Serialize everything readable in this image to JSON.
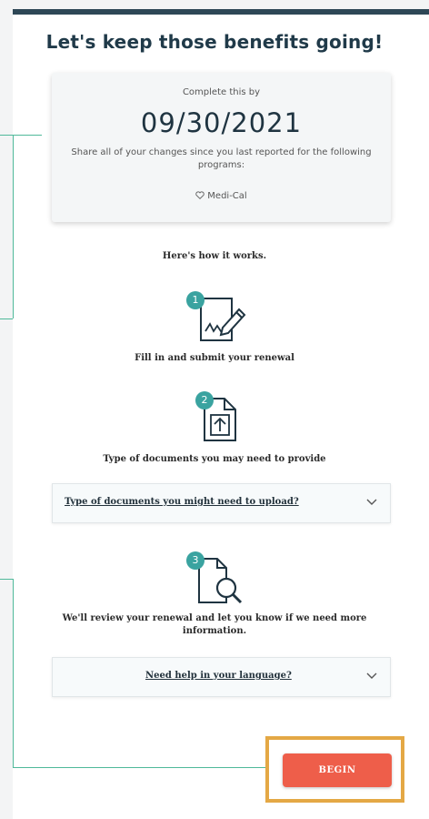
{
  "page": {
    "title": "Let's keep those benefits going!"
  },
  "info_card": {
    "complete_by_label": "Complete this by",
    "due_date": "09/30/2021",
    "share_text": "Share all of your changes since you last reported for the following programs:",
    "program": "Medi-Cal",
    "program_icon": "heart-icon"
  },
  "how_it_works": {
    "heading": "Here's how it works.",
    "steps": [
      {
        "number": "1",
        "text": "Fill in and submit your renewal",
        "icon": "form-signature-icon"
      },
      {
        "number": "2",
        "text": "Type of documents you may need to provide",
        "icon": "document-upload-icon"
      },
      {
        "number": "3",
        "text": "We'll review your renewal and let you know if we need more information.",
        "icon": "document-search-icon"
      }
    ]
  },
  "accordions": {
    "documents": {
      "label": "Type of documents you might need to upload?"
    },
    "language": {
      "label": "Need help in your language?"
    }
  },
  "actions": {
    "begin_label": "BEGIN"
  },
  "colors": {
    "heading": "#203a49",
    "accent_teal": "#3aa3a0",
    "begin_button": "#ee5e4a",
    "highlight_border": "#e4a845",
    "connector_line": "#4fb99a"
  }
}
